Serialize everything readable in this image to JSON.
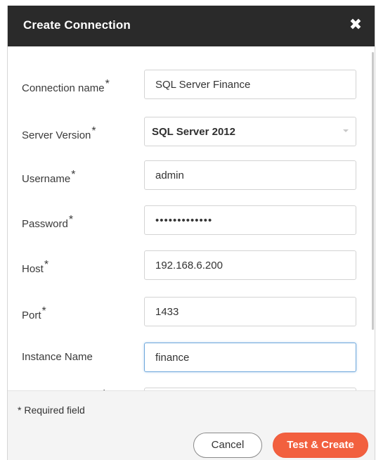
{
  "dialog": {
    "title": "Create Connection",
    "close_symbol": "✖"
  },
  "form": {
    "required_marker": "*",
    "connection_name": {
      "label": "Connection name",
      "value": "SQL Server Finance"
    },
    "server_version": {
      "label": "Server Version",
      "value": "SQL Server 2012"
    },
    "username": {
      "label": "Username",
      "value": "admin"
    },
    "password": {
      "label": "Password",
      "value": "•••••••••••••"
    },
    "host": {
      "label": "Host",
      "value": "192.168.6.200"
    },
    "port": {
      "label": "Port",
      "value": "1433"
    },
    "instance_name": {
      "label": "Instance Name",
      "value": "finance"
    }
  },
  "footer": {
    "required_note": "* Required field",
    "cancel_label": "Cancel",
    "primary_label": "Test & Create"
  },
  "colors": {
    "titlebar": "#2a2a2a",
    "primary": "#f2603f",
    "focus_border": "#6fa8dc"
  },
  "icons": {
    "close": "close-icon",
    "dropdown": "chevron-down-icon"
  }
}
